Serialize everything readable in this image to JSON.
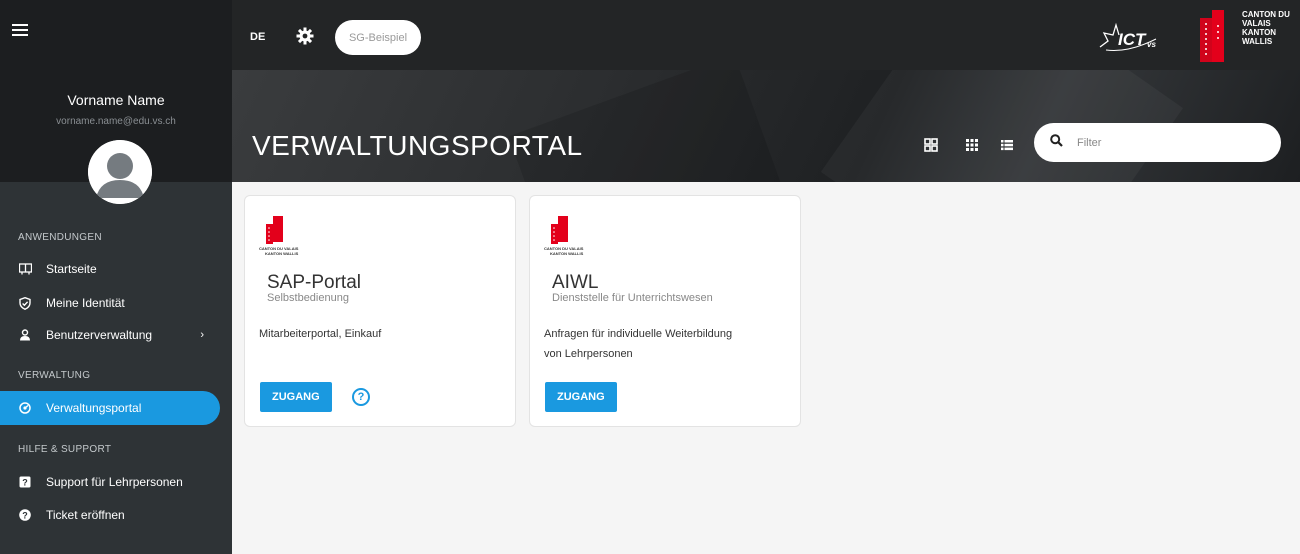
{
  "topbar": {
    "lang": "DE",
    "sg_label": "SG-Beispiel",
    "canton_line1": "CANTON DU VALAIS",
    "canton_line2": "KANTON WALLIS"
  },
  "user": {
    "name": "Vorname Name",
    "email": "vorname.name@edu.vs.ch"
  },
  "sidebar": {
    "sections": [
      {
        "label": "ANWENDUNGEN"
      },
      {
        "label": "VERWALTUNG"
      },
      {
        "label": "HILFE & SUPPORT"
      }
    ],
    "items": [
      {
        "label": "Startseite",
        "icon": "book-open-icon"
      },
      {
        "label": "Meine Identität",
        "icon": "shield-check-icon"
      },
      {
        "label": "Benutzerverwaltung",
        "icon": "users-icon",
        "chevron": "›"
      },
      {
        "label": "Verwaltungsportal",
        "icon": "dashboard-icon",
        "active": true
      },
      {
        "label": "Support für Lehrpersonen",
        "icon": "question-square-icon"
      },
      {
        "label": "Ticket eröffnen",
        "icon": "question-circle-icon"
      }
    ]
  },
  "banner": {
    "title": "VERWALTUNGSPORTAL",
    "filter_placeholder": "Filter"
  },
  "cards": [
    {
      "logo_line1": "CANTON DU VALAIS",
      "logo_line2": "KANTON WALLIS",
      "title": "SAP-Portal",
      "subtitle": "Selbstbedienung",
      "description": "Mitarbeiterportal, Einkauf",
      "button": "ZUGANG",
      "help": "?"
    },
    {
      "logo_line1": "CANTON DU VALAIS",
      "logo_line2": "KANTON WALLIS",
      "title": "AIWL",
      "subtitle": "Dienststelle für Unterrichtswesen",
      "description": "Anfragen für individuelle Weiterbildung von Lehrpersonen",
      "button": "ZUGANG"
    }
  ],
  "colors": {
    "accent": "#1a99e0",
    "sidebar_bg": "#2e3336",
    "topbar_bg": "#232526",
    "canton_red": "#e3001b"
  }
}
